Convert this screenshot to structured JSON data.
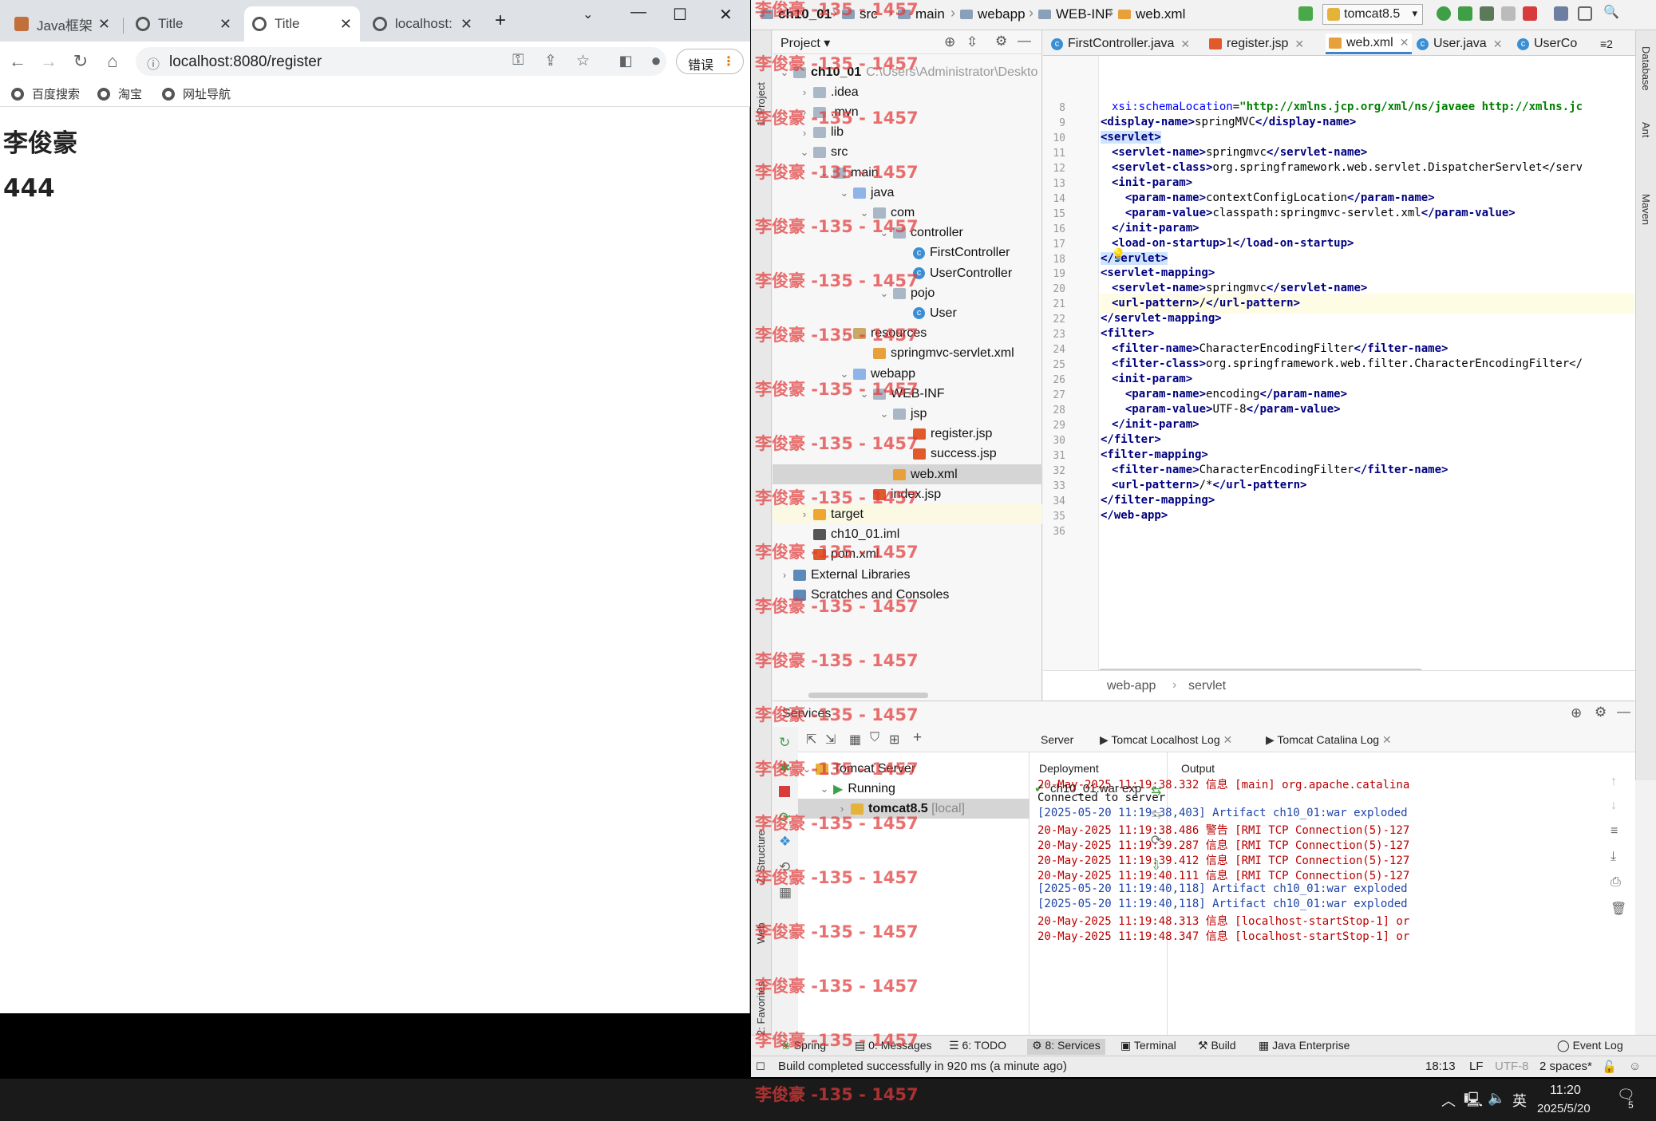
{
  "browser": {
    "tabs": [
      {
        "title": "Java框架开"
      },
      {
        "title": "Title"
      },
      {
        "title": "Title"
      },
      {
        "title": "localhost:"
      }
    ],
    "url": "localhost:8080/register",
    "error_button": "错误",
    "bookmarks": [
      "百度搜索",
      "淘宝",
      "网址导航"
    ],
    "page": {
      "heading1": "李俊豪",
      "heading2": "444"
    }
  },
  "ide": {
    "breadcrumbs": [
      "ch10_01",
      "src",
      "main",
      "webapp",
      "WEB-INF",
      "web.xml"
    ],
    "run_config": "tomcat8.5",
    "project_panel": {
      "title": "Project",
      "tree": [
        {
          "label": "ch10_01",
          "path": "C:\\Users\\Administrator\\Deskto",
          "icon": "module-folder-icon"
        },
        {
          "label": ".idea",
          "icon": "folder-icon"
        },
        {
          "label": ".mvn",
          "icon": "folder-icon"
        },
        {
          "label": "lib",
          "icon": "folder-icon"
        },
        {
          "label": "src",
          "icon": "folder-icon"
        },
        {
          "label": "main",
          "icon": "folder-icon"
        },
        {
          "label": "java",
          "icon": "source-folder-icon"
        },
        {
          "label": "com",
          "icon": "package-icon"
        },
        {
          "label": "controller",
          "icon": "package-icon"
        },
        {
          "label": "FirstController",
          "icon": "class-icon"
        },
        {
          "label": "UserController",
          "icon": "class-icon"
        },
        {
          "label": "pojo",
          "icon": "package-icon"
        },
        {
          "label": "User",
          "icon": "class-icon"
        },
        {
          "label": "resources",
          "icon": "resources-folder-icon"
        },
        {
          "label": "springmvc-servlet.xml",
          "icon": "xml-file-icon"
        },
        {
          "label": "webapp",
          "icon": "web-folder-icon"
        },
        {
          "label": "WEB-INF",
          "icon": "folder-icon"
        },
        {
          "label": "jsp",
          "icon": "folder-icon"
        },
        {
          "label": "register.jsp",
          "icon": "jsp-file-icon"
        },
        {
          "label": "success.jsp",
          "icon": "jsp-file-icon"
        },
        {
          "label": "web.xml",
          "icon": "xml-file-icon"
        },
        {
          "label": "index.jsp",
          "icon": "jsp-file-icon"
        },
        {
          "label": "target",
          "icon": "excluded-folder-icon"
        },
        {
          "label": "ch10_01.iml",
          "icon": "module-file-icon"
        },
        {
          "label": "pom.xml",
          "icon": "maven-file-icon"
        },
        {
          "label": "External Libraries",
          "icon": "library-icon"
        },
        {
          "label": "Scratches and Consoles",
          "icon": "scratches-icon"
        }
      ]
    },
    "editor": {
      "tabs": [
        "FirstController.java",
        "register.jsp",
        "web.xml",
        "User.java",
        "UserCo"
      ],
      "overflow_tabs": "≡2",
      "lines": [
        {
          "n": "8",
          "text": "  xsi:schemaLocation=\"http://xmlns.jcp.org/xml/ns/javaee http://xmlns.jc"
        },
        {
          "n": "9",
          "text": "<display-name>springMVC</display-name>"
        },
        {
          "n": "10",
          "text": "<servlet>"
        },
        {
          "n": "11",
          "text": "  <servlet-name>springmvc</servlet-name>"
        },
        {
          "n": "12",
          "text": "  <servlet-class>org.springframework.web.servlet.DispatcherServlet</serv"
        },
        {
          "n": "13",
          "text": "  <init-param>"
        },
        {
          "n": "14",
          "text": "    <param-name>contextConfigLocation</param-name>"
        },
        {
          "n": "15",
          "text": "    <param-value>classpath:springmvc-servlet.xml</param-value>"
        },
        {
          "n": "16",
          "text": "  </init-param>"
        },
        {
          "n": "17",
          "text": "  <load-on-startup>1</load-on-startup>"
        },
        {
          "n": "18",
          "text": "</servlet>"
        },
        {
          "n": "19",
          "text": "<servlet-mapping>"
        },
        {
          "n": "20",
          "text": "  <servlet-name>springmvc</servlet-name>"
        },
        {
          "n": "21",
          "text": "  <url-pattern>/</url-pattern>"
        },
        {
          "n": "22",
          "text": "</servlet-mapping>"
        },
        {
          "n": "23",
          "text": "<filter>"
        },
        {
          "n": "24",
          "text": "  <filter-name>CharacterEncodingFilter</filter-name>"
        },
        {
          "n": "25",
          "text": "  <filter-class>org.springframework.web.filter.CharacterEncodingFilter</"
        },
        {
          "n": "26",
          "text": "  <init-param>"
        },
        {
          "n": "27",
          "text": "    <param-name>encoding</param-name>"
        },
        {
          "n": "28",
          "text": "    <param-value>UTF-8</param-value>"
        },
        {
          "n": "29",
          "text": "  </init-param>"
        },
        {
          "n": "30",
          "text": "</filter>"
        },
        {
          "n": "31",
          "text": "<filter-mapping>"
        },
        {
          "n": "32",
          "text": "  <filter-name>CharacterEncodingFilter</filter-name>"
        },
        {
          "n": "33",
          "text": "  <url-pattern>/*</url-pattern>"
        },
        {
          "n": "34",
          "text": "</filter-mapping>"
        },
        {
          "n": "35",
          "text": "</web-app>"
        },
        {
          "n": "36",
          "text": ""
        }
      ],
      "breadcrumb": [
        "web-app",
        "servlet"
      ]
    },
    "services": {
      "title": "Services",
      "tree": [
        {
          "label": "Tomcat Server"
        },
        {
          "label": "Running"
        },
        {
          "label": "tomcat8.5",
          "suffix": "[local]"
        }
      ],
      "tabs": [
        "Server",
        "Tomcat Localhost Log",
        "Tomcat Catalina Log"
      ],
      "deployment_label": "Deployment",
      "output_label": "Output",
      "deployment_item": "ch10_01:war exp",
      "log": [
        {
          "text": "20-May-2025 11:19:38.332 信息 [main] org.apache.catalina",
          "kind": "red"
        },
        {
          "text": "Connected to server",
          "kind": "black"
        },
        {
          "text": "[2025-05-20 11:19:38,403] Artifact ch10_01:war exploded",
          "kind": "blue"
        },
        {
          "text": "20-May-2025 11:19:38.486 警告 [RMI TCP Connection(5)-127",
          "kind": "red"
        },
        {
          "text": "20-May-2025 11:19:39.287 信息 [RMI TCP Connection(5)-127",
          "kind": "red"
        },
        {
          "text": "20-May-2025 11:19:39.412 信息 [RMI TCP Connection(5)-127",
          "kind": "red"
        },
        {
          "text": "20-May-2025 11:19:40.111 信息 [RMI TCP Connection(5)-127",
          "kind": "red"
        },
        {
          "text": "[2025-05-20 11:19:40,118] Artifact ch10_01:war exploded",
          "kind": "blue"
        },
        {
          "text": "[2025-05-20 11:19:40,118] Artifact ch10_01:war exploded",
          "kind": "blue"
        },
        {
          "text": "20-May-2025 11:19:48.313 信息 [localhost-startStop-1] or",
          "kind": "red"
        },
        {
          "text": "20-May-2025 11:19:48.347 信息 [localhost-startStop-1] or",
          "kind": "red"
        }
      ]
    },
    "left_stripe": [
      "1: Project",
      "Z: Structure",
      "Web",
      "2: Favorites"
    ],
    "right_stripe": [
      "Database",
      "Ant",
      "Maven"
    ],
    "tool_windows": [
      "Spring",
      "0: Messages",
      "6: TODO",
      "8: Services",
      "Terminal",
      "Build",
      "Java Enterprise"
    ],
    "event_log": "Event Log",
    "status": {
      "message": "Build completed successfully in 920 ms (a minute ago)",
      "position": "18:13",
      "line_sep": "LF",
      "encoding": "UTF-8",
      "indent": "2 spaces*"
    }
  },
  "taskbar": {
    "ime": "英",
    "time": "11:20",
    "date": "2025/5/20",
    "notification_count": "5"
  },
  "watermark": "李俊豪 -135 - 1457",
  "colors": {
    "watermark": "#e33a3a",
    "tag": "#000080",
    "value": "#008000",
    "log_red": "#bb0000",
    "log_blue": "#1f44a8",
    "accent": "#4083c9"
  }
}
